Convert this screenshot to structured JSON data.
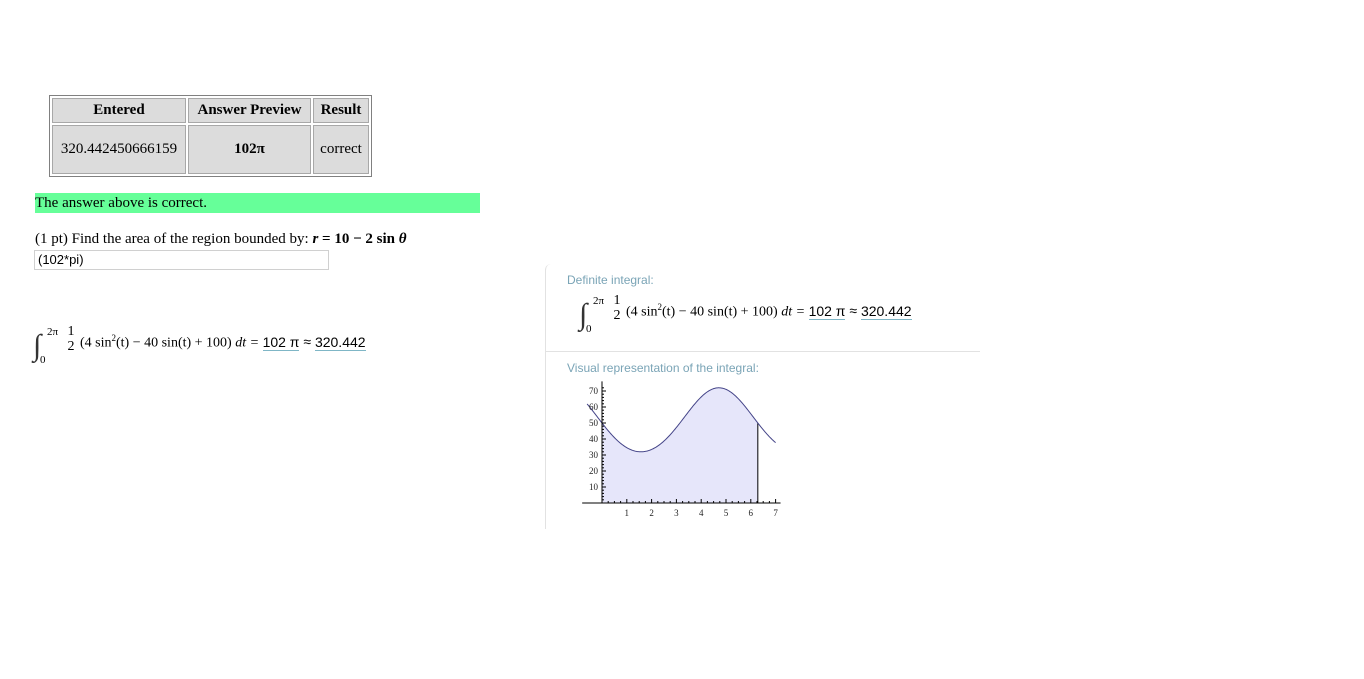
{
  "results_table": {
    "headers": [
      "Entered",
      "Answer Preview",
      "Result"
    ],
    "row": {
      "entered": "320.442450666159",
      "preview": "102π",
      "result": "correct"
    }
  },
  "banner": {
    "text": "The answer above is correct.",
    "color": "#66ff99"
  },
  "question": {
    "prefix": "(1 pt) Find the area of the region bounded by:",
    "r": "r",
    "eq": " = 10 − 2 sin ",
    "theta": "θ"
  },
  "answer_input": {
    "value": "(102*pi)"
  },
  "integral": {
    "upper": "2π",
    "lower": "0",
    "frac_num": "1",
    "frac_den": "2",
    "integrand_part1": "(4 sin",
    "power": "2",
    "integrand_part2": "(t) − 40 sin(t) + 100)",
    "dt": " dt = ",
    "exact": "102 π",
    "approx_sym": " ≈ ",
    "approx": "320.442"
  },
  "panel": {
    "definite_label": "Definite integral:",
    "visual_label": "Visual representation of the integral:"
  },
  "chart_data": {
    "type": "area",
    "function": "1/2 (4 sin^2(t) - 40 sin(t) + 100)",
    "x_ticks": [
      "1",
      "2",
      "3",
      "4",
      "5",
      "6",
      "7"
    ],
    "y_ticks": [
      "10",
      "20",
      "30",
      "40",
      "50",
      "60",
      "70"
    ],
    "xlim": [
      0,
      7.0
    ],
    "ylim": [
      0,
      72
    ],
    "shaded_interval": [
      0,
      6.2832
    ],
    "fill_color": "#e6e6fa",
    "line_color": "#444488"
  }
}
